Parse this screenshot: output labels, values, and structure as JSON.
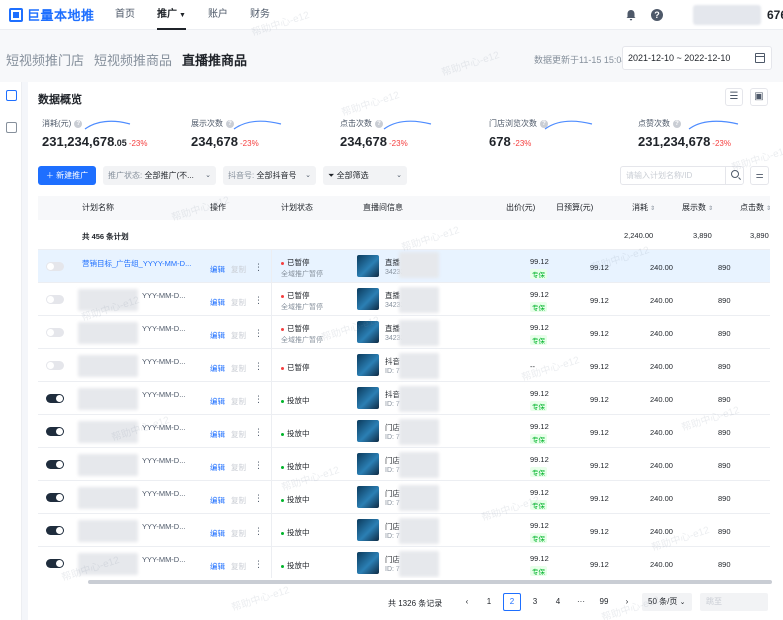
{
  "app": {
    "logo": "巨量本地推",
    "user_num": "676"
  },
  "nav": [
    {
      "label": "首页",
      "active": false
    },
    {
      "label": "推广",
      "active": true
    },
    {
      "label": "账户",
      "active": false
    },
    {
      "label": "财务",
      "active": false
    }
  ],
  "page_tabs": [
    {
      "label": "短视频推门店",
      "active": false
    },
    {
      "label": "短视频推商品",
      "active": false
    },
    {
      "label": "直播推商品",
      "active": true
    }
  ],
  "header": {
    "updated": "数据更新于11-15 15:04",
    "date_range": "2021-12-10 ~ 2022-12-10"
  },
  "overview": {
    "title": "数据概览",
    "metrics": [
      {
        "label": "消耗(元)",
        "value": "231,234,678",
        "decimal": ".05",
        "change": "-23%"
      },
      {
        "label": "展示次数",
        "value": "234,678",
        "decimal": "",
        "change": "-23%"
      },
      {
        "label": "点击次数",
        "value": "234,678",
        "decimal": "",
        "change": "-23%"
      },
      {
        "label": "门店浏览次数",
        "value": "678",
        "decimal": "",
        "change": "-23%"
      },
      {
        "label": "点赞次数",
        "value": "231,234,678",
        "decimal": "",
        "change": "-23%"
      }
    ]
  },
  "filters": {
    "new_button": "新建推广",
    "status_label": "推广状态:",
    "status_value": "全部推广(不...",
    "account_label": "抖音号:",
    "account_value": "全部抖音号",
    "filter_all": "全部筛选",
    "search_placeholder": "请输入计划名称/ID"
  },
  "table": {
    "columns": {
      "plan": "计划名称",
      "ops": "操作",
      "status": "计划状态",
      "live": "直播间信息",
      "bid": "出价(元)",
      "budget": "日预算(元)",
      "cost": "消耗",
      "impressions": "展示数",
      "clicks": "点击数"
    },
    "total": {
      "label": "共 456 条计划",
      "cost": "2,240.00",
      "impressions": "3,890",
      "clicks": "3,890"
    },
    "rows": [
      {
        "toggle": "off",
        "name": "营销目标_广告组_YYYY-MM-D...",
        "highlight": true,
        "edit": "编辑",
        "copy": "复制",
        "status": "已暂停",
        "status_color": "#f53f3f",
        "status_sub": "全域推广暂停",
        "live_name": "直播",
        "live_id": "34232",
        "bid": "99.12",
        "bid_tag": "专保",
        "budget": "99.12",
        "cost": "240.00",
        "impressions": "890"
      },
      {
        "toggle": "off",
        "name": "YYY-MM-D...",
        "highlight": false,
        "edit": "编辑",
        "copy": "复制",
        "status": "已暂停",
        "status_color": "#f53f3f",
        "status_sub": "全域推广暂停",
        "live_name": "直播",
        "live_id": "34232",
        "bid": "99.12",
        "bid_tag": "专保",
        "budget": "99.12",
        "cost": "240.00",
        "impressions": "890"
      },
      {
        "toggle": "off",
        "name": "YYY-MM-D...",
        "highlight": false,
        "edit": "编辑",
        "copy": "复制",
        "status": "已暂停",
        "status_color": "#f53f3f",
        "status_sub": "全域推广暂停",
        "live_name": "直播",
        "live_id": "34232",
        "bid": "99.12",
        "bid_tag": "专保",
        "budget": "99.12",
        "cost": "240.00",
        "impressions": "890"
      },
      {
        "toggle": "off",
        "name": "YYY-MM-D...",
        "highlight": false,
        "edit": "编辑",
        "copy": "复制",
        "status": "已暂停",
        "status_color": "#f53f3f",
        "status_sub": "",
        "live_name": "抖音",
        "live_id": "ID: 7",
        "bid": "--",
        "bid_tag": "",
        "budget": "99.12",
        "cost": "240.00",
        "impressions": "890"
      },
      {
        "toggle": "on",
        "name": "YYY-MM-D...",
        "highlight": false,
        "edit": "编辑",
        "copy": "复制",
        "status": "投放中",
        "status_color": "#00b42a",
        "status_sub": "",
        "live_name": "抖音",
        "live_id": "ID: 7",
        "bid": "99.12",
        "bid_tag": "专保",
        "budget": "99.12",
        "cost": "240.00",
        "impressions": "890"
      },
      {
        "toggle": "on",
        "name": "YYY-MM-D...",
        "highlight": false,
        "edit": "编辑",
        "copy": "复制",
        "status": "投放中",
        "status_color": "#00b42a",
        "status_sub": "",
        "live_name": "门店",
        "live_id": "ID: 7",
        "bid": "99.12",
        "bid_tag": "专保",
        "budget": "99.12",
        "cost": "240.00",
        "impressions": "890"
      },
      {
        "toggle": "on",
        "name": "YYY-MM-D...",
        "highlight": false,
        "edit": "编辑",
        "copy": "复制",
        "status": "投放中",
        "status_color": "#00b42a",
        "status_sub": "",
        "live_name": "门店",
        "live_id": "ID: 7",
        "bid": "99.12",
        "bid_tag": "专保",
        "budget": "99.12",
        "cost": "240.00",
        "impressions": "890"
      },
      {
        "toggle": "on",
        "name": "YYY-MM-D...",
        "highlight": false,
        "edit": "编辑",
        "copy": "复制",
        "status": "投放中",
        "status_color": "#00b42a",
        "status_sub": "",
        "live_name": "门店",
        "live_id": "ID: 7",
        "bid": "99.12",
        "bid_tag": "专保",
        "budget": "99.12",
        "cost": "240.00",
        "impressions": "890"
      },
      {
        "toggle": "on",
        "name": "YYY-MM-D...",
        "highlight": false,
        "edit": "编辑",
        "copy": "复制",
        "status": "投放中",
        "status_color": "#00b42a",
        "status_sub": "",
        "live_name": "门店",
        "live_id": "ID: 7",
        "bid": "99.12",
        "bid_tag": "专保",
        "budget": "99.12",
        "cost": "240.00",
        "impressions": "890"
      },
      {
        "toggle": "on",
        "name": "YYY-MM-D...",
        "highlight": false,
        "edit": "编辑",
        "copy": "复制",
        "status": "投放中",
        "status_color": "#00b42a",
        "status_sub": "",
        "live_name": "门店",
        "live_id": "ID: 7",
        "bid": "99.12",
        "bid_tag": "专保",
        "budget": "99.12",
        "cost": "240.00",
        "impressions": "890"
      }
    ]
  },
  "pagination": {
    "total": "共 1326 条记录",
    "pages": [
      "1",
      "2",
      "3",
      "4",
      "···",
      "99"
    ],
    "current": "2",
    "page_size": "50 条/页",
    "jump_placeholder": "跳至"
  },
  "watermark": "帮助中心-e12",
  "colors": {
    "accent": "#1e6fff",
    "paused": "#f53f3f",
    "running": "#00b42a",
    "change_down": "#f53f3f"
  }
}
